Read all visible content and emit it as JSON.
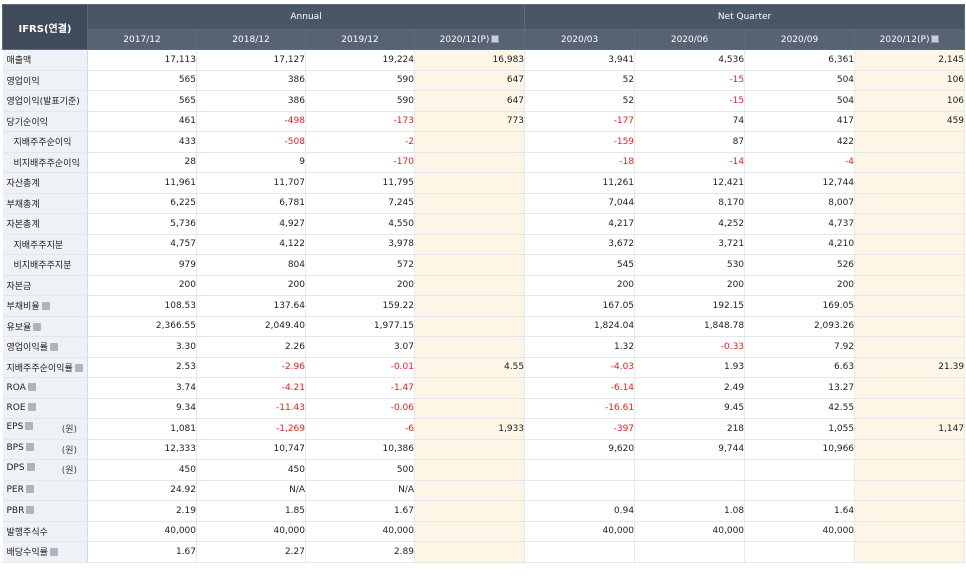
{
  "corner_label": "IFRS(연결)",
  "groups": [
    {
      "label": "Annual",
      "span": 4
    },
    {
      "label": "Net Quarter",
      "span": 4
    }
  ],
  "columns": [
    {
      "label": "2017/12",
      "est": false
    },
    {
      "label": "2018/12",
      "est": false
    },
    {
      "label": "2019/12",
      "est": false
    },
    {
      "label": "2020/12(P)",
      "est": true,
      "icon": "sort-icon"
    },
    {
      "label": "2020/03",
      "est": false
    },
    {
      "label": "2020/06",
      "est": false
    },
    {
      "label": "2020/09",
      "est": false
    },
    {
      "label": "2020/12(P)",
      "est": true,
      "icon": "sort-icon"
    }
  ],
  "rows": [
    {
      "label": "매출액",
      "values": [
        "17,113",
        "17,127",
        "19,224",
        "16,983",
        "3,941",
        "4,536",
        "6,361",
        "2,145"
      ]
    },
    {
      "label": "영업이익",
      "values": [
        "565",
        "386",
        "590",
        "647",
        "52",
        "-15",
        "504",
        "106"
      ]
    },
    {
      "label": "영업이익(발표기준)",
      "values": [
        "565",
        "386",
        "590",
        "647",
        "52",
        "-15",
        "504",
        "106"
      ]
    },
    {
      "label": "당기순이익",
      "values": [
        "461",
        "-498",
        "-173",
        "773",
        "-177",
        "74",
        "417",
        "459"
      ]
    },
    {
      "label": "지배주주순이익",
      "sub": true,
      "values": [
        "433",
        "-508",
        "-2",
        "",
        "-159",
        "87",
        "422",
        ""
      ]
    },
    {
      "label": "비지배주주순이익",
      "sub": true,
      "values": [
        "28",
        "9",
        "-170",
        "",
        "-18",
        "-14",
        "-4",
        ""
      ]
    },
    {
      "label": "자산총계",
      "values": [
        "11,961",
        "11,707",
        "11,795",
        "",
        "11,261",
        "12,421",
        "12,744",
        ""
      ]
    },
    {
      "label": "부채총계",
      "values": [
        "6,225",
        "6,781",
        "7,245",
        "",
        "7,044",
        "8,170",
        "8,007",
        ""
      ]
    },
    {
      "label": "자본총계",
      "values": [
        "5,736",
        "4,927",
        "4,550",
        "",
        "4,217",
        "4,252",
        "4,737",
        ""
      ]
    },
    {
      "label": "지배주주지분",
      "sub": true,
      "values": [
        "4,757",
        "4,122",
        "3,978",
        "",
        "3,672",
        "3,721",
        "4,210",
        ""
      ]
    },
    {
      "label": "비지배주주지분",
      "sub": true,
      "values": [
        "979",
        "804",
        "572",
        "",
        "545",
        "530",
        "526",
        ""
      ]
    },
    {
      "label": "자본금",
      "values": [
        "200",
        "200",
        "200",
        "",
        "200",
        "200",
        "200",
        ""
      ]
    },
    {
      "label": "부채비율",
      "info": true,
      "values": [
        "108.53",
        "137.64",
        "159.22",
        "",
        "167.05",
        "192.15",
        "169.05",
        ""
      ]
    },
    {
      "label": "유보율",
      "info": true,
      "values": [
        "2,366.55",
        "2,049.40",
        "1,977.15",
        "",
        "1,824.04",
        "1,848.78",
        "2,093.26",
        ""
      ]
    },
    {
      "label": "영업이익률",
      "info": true,
      "values": [
        "3.30",
        "2.26",
        "3.07",
        "",
        "1.32",
        "-0.33",
        "7.92",
        ""
      ]
    },
    {
      "label": "지배주주순이익률",
      "info": true,
      "values": [
        "2.53",
        "-2.96",
        "-0.01",
        "4.55",
        "-4.03",
        "1.93",
        "6.63",
        "21.39"
      ]
    },
    {
      "label": "ROA",
      "info": true,
      "values": [
        "3.74",
        "-4.21",
        "-1.47",
        "",
        "-6.14",
        "2.49",
        "13.27",
        ""
      ]
    },
    {
      "label": "ROE",
      "info": true,
      "values": [
        "9.34",
        "-11.43",
        "-0.06",
        "",
        "-16.61",
        "9.45",
        "42.55",
        ""
      ]
    },
    {
      "label": "EPS",
      "info": true,
      "unit": "(원)",
      "values": [
        "1,081",
        "-1,269",
        "-6",
        "1,933",
        "-397",
        "218",
        "1,055",
        "1,147"
      ]
    },
    {
      "label": "BPS",
      "info": true,
      "unit": "(원)",
      "values": [
        "12,333",
        "10,747",
        "10,386",
        "",
        "9,620",
        "9,744",
        "10,966",
        ""
      ]
    },
    {
      "label": "DPS",
      "info": true,
      "unit": "(원)",
      "values": [
        "450",
        "450",
        "500",
        "",
        "",
        "",
        "",
        ""
      ]
    },
    {
      "label": "PER",
      "info": true,
      "values": [
        "24.92",
        "N/A",
        "N/A",
        "",
        "",
        "",
        "",
        ""
      ]
    },
    {
      "label": "PBR",
      "info": true,
      "values": [
        "2.19",
        "1.85",
        "1.67",
        "",
        "0.94",
        "1.08",
        "1.64",
        ""
      ]
    },
    {
      "label": "발행주식수",
      "values": [
        "40,000",
        "40,000",
        "40,000",
        "",
        "40,000",
        "40,000",
        "40,000",
        ""
      ]
    },
    {
      "label": "배당수익률",
      "info": true,
      "values": [
        "1.67",
        "2.27",
        "2.89",
        "",
        "",
        "",
        "",
        ""
      ]
    }
  ],
  "colors": {
    "header_bg": "#4a5566",
    "estimate_bg": "#fdf5e6",
    "label_bg": "#eef1f5",
    "negative": "#e02020"
  }
}
